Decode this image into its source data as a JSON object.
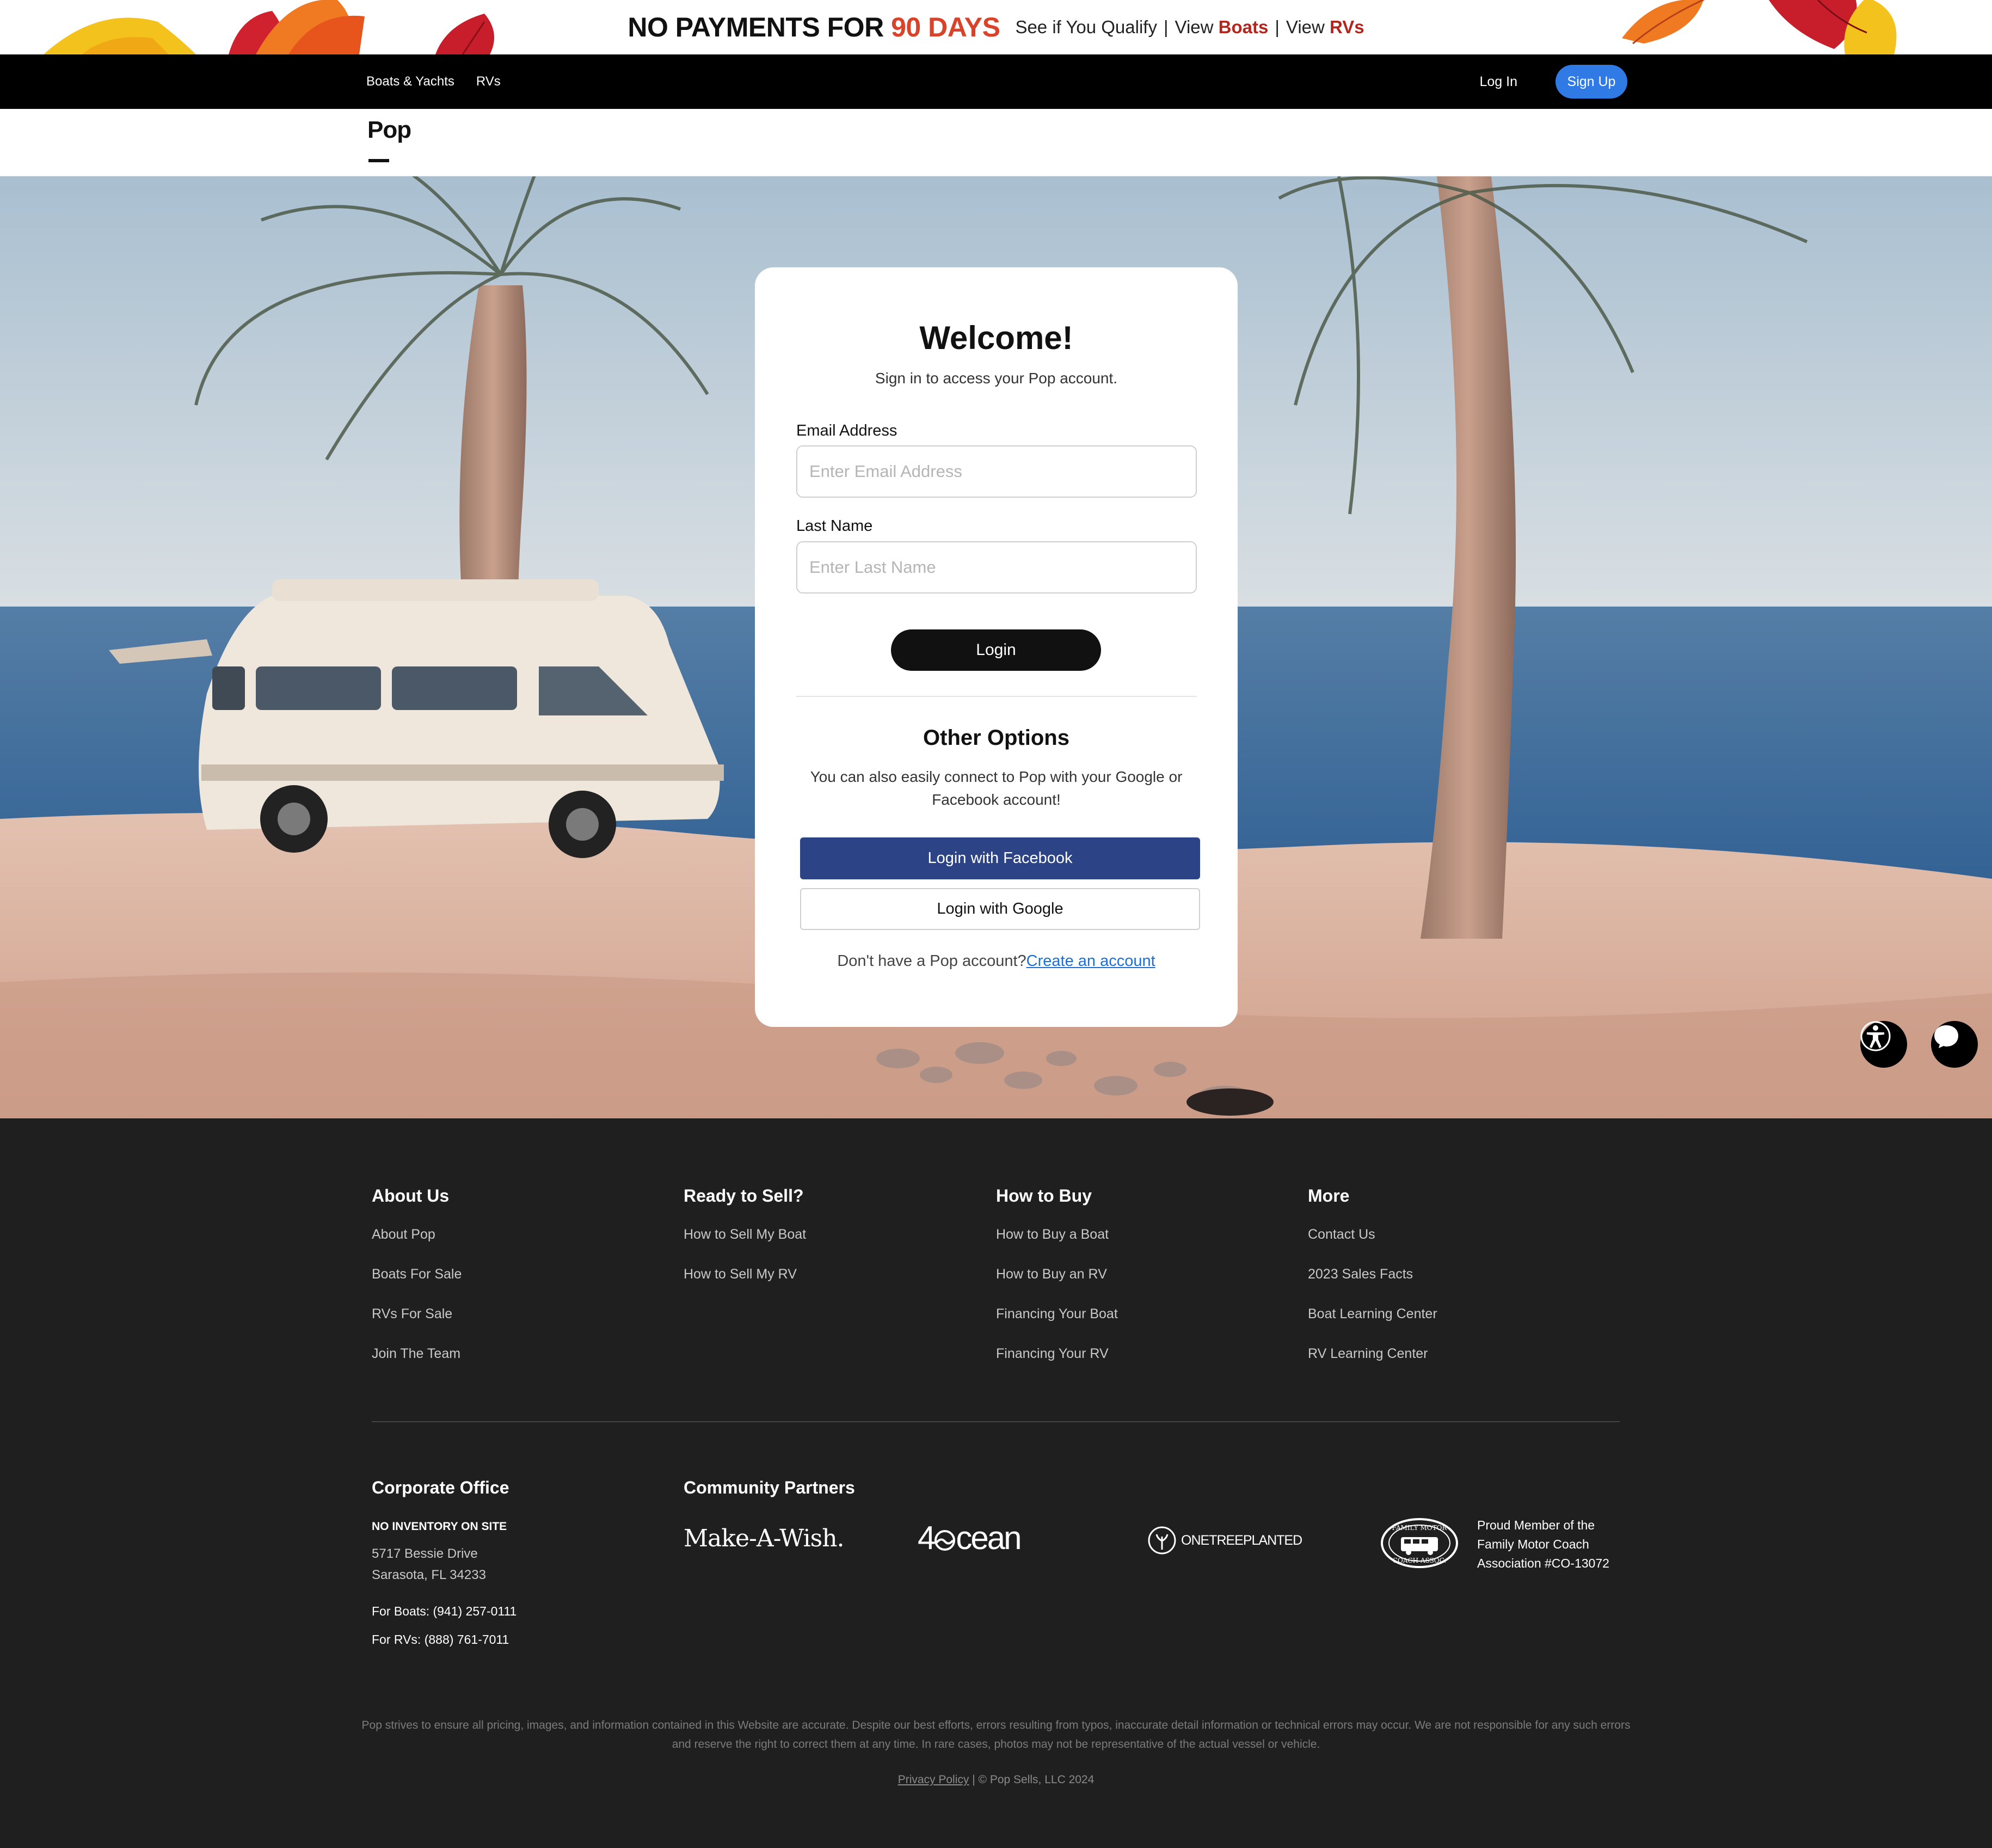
{
  "promo": {
    "headline_prefix": "NO PAYMENTS FOR",
    "headline_highlight": "90 DAYS",
    "qualify_text": "See if You Qualify",
    "sep": "|",
    "view_boats_prefix": "View",
    "view_boats_highlight": "Boats",
    "view_rvs_prefix": "View",
    "view_rvs_highlight": "RVs"
  },
  "nav": {
    "links": [
      "Boats & Yachts",
      "RVs"
    ],
    "login_label": "Log In",
    "signup_label": "Sign Up"
  },
  "brand": {
    "logo_text": "Pop"
  },
  "login_card": {
    "title": "Welcome!",
    "subtitle": "Sign in to access your Pop account.",
    "email_label": "Email Address",
    "email_placeholder": "Enter Email Address",
    "email_value": "",
    "lastname_label": "Last Name",
    "lastname_placeholder": "Enter Last Name",
    "lastname_value": "",
    "login_button": "Login",
    "other_title": "Other Options",
    "other_text": "You can also easily connect to Pop with your Google or Facebook account!",
    "facebook_button": "Login with Facebook",
    "google_button": "Login with Google",
    "no_account_text": "Don't have a Pop account?",
    "create_account_link": "Create an account"
  },
  "floating": {
    "accessibility_icon": "accessibility-icon",
    "chat_icon": "chat-bubble-icon"
  },
  "footer": {
    "columns": [
      {
        "title": "About Us",
        "links": [
          "About Pop",
          "Boats For Sale",
          "RVs For Sale",
          "Join The Team"
        ]
      },
      {
        "title": "Ready to Sell?",
        "links": [
          "How to Sell My Boat",
          "How to Sell My RV"
        ]
      },
      {
        "title": "How to Buy",
        "links": [
          "How to Buy a Boat",
          "How to Buy an RV",
          "Financing Your Boat",
          "Financing Your RV"
        ]
      },
      {
        "title": "More",
        "links": [
          "Contact Us",
          "2023 Sales Facts",
          "Boat Learning Center",
          "RV Learning Center"
        ]
      }
    ],
    "office": {
      "title": "Corporate Office",
      "badge": "NO INVENTORY ON SITE",
      "address_line1": "5717 Bessie Drive",
      "address_line2": "Sarasota, FL 34233",
      "boats_phone": "For Boats: (941) 257-0111",
      "rvs_phone": "For RVs: (888) 761-7011"
    },
    "partners": {
      "title": "Community Partners",
      "make_a_wish": "Make-A-Wish.",
      "ocean_prefix": "4",
      "ocean_suffix": "cean",
      "one_tree_planted": "ONETREEPLANTED",
      "fmca_badge_top": "FAMILY MOTOR",
      "fmca_badge_bottom": "COACH ASSOC.",
      "fmca_text": "Proud Member of the Family Motor Coach Association #CO-13072"
    },
    "disclaimer": "Pop strives to ensure all pricing, images, and information contained in this Website are accurate. Despite our best efforts, errors resulting from typos, inaccurate detail information or technical errors may occur. We are not responsible for any such errors and reserve the right to correct them at any time. In rare cases, photos may not be representative of the actual vessel or vehicle.",
    "privacy_link": "Privacy Policy",
    "copyright": "| © Pop Sells, LLC 2024"
  },
  "colors": {
    "accent_blue": "#2f7ae5",
    "facebook_blue": "#2c4486",
    "promo_orange": "#d9432a",
    "promo_red": "#b3261e",
    "footer_bg": "#1f1f1f"
  }
}
